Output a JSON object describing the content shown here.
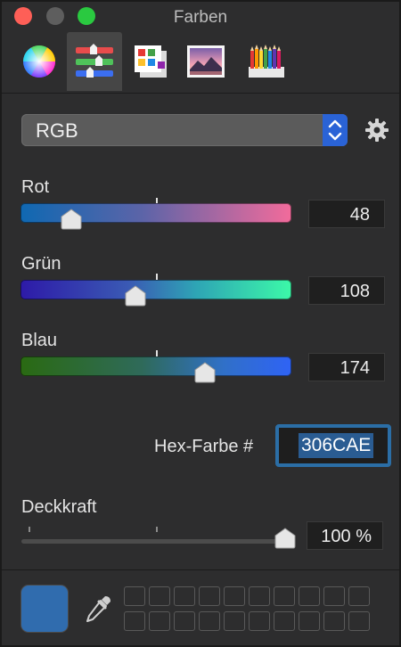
{
  "window": {
    "title": "Farben"
  },
  "toolbar": {
    "tools": [
      {
        "icon": "color-wheel-icon",
        "active": false
      },
      {
        "icon": "color-sliders-icon",
        "active": true
      },
      {
        "icon": "color-palettes-icon",
        "active": false
      },
      {
        "icon": "image-palettes-icon",
        "active": false
      },
      {
        "icon": "pencils-icon",
        "active": false
      }
    ]
  },
  "model": {
    "selected": "RGB",
    "gear_icon": "gear-icon"
  },
  "sliders": [
    {
      "label": "Rot",
      "value": "48",
      "fraction": 0.188
    },
    {
      "label": "Grün",
      "value": "108",
      "fraction": 0.424
    },
    {
      "label": "Blau",
      "value": "174",
      "fraction": 0.682
    }
  ],
  "hex": {
    "label": "Hex-Farbe #",
    "value": "306CAE"
  },
  "opacity": {
    "label": "Deckkraft",
    "value": "100 %",
    "fraction": 1.0
  },
  "current_color": "#306cae",
  "colors": {
    "accent": "#2a63d6",
    "focus_ring": "#2b6ea6",
    "selection": "#2a5c92"
  }
}
